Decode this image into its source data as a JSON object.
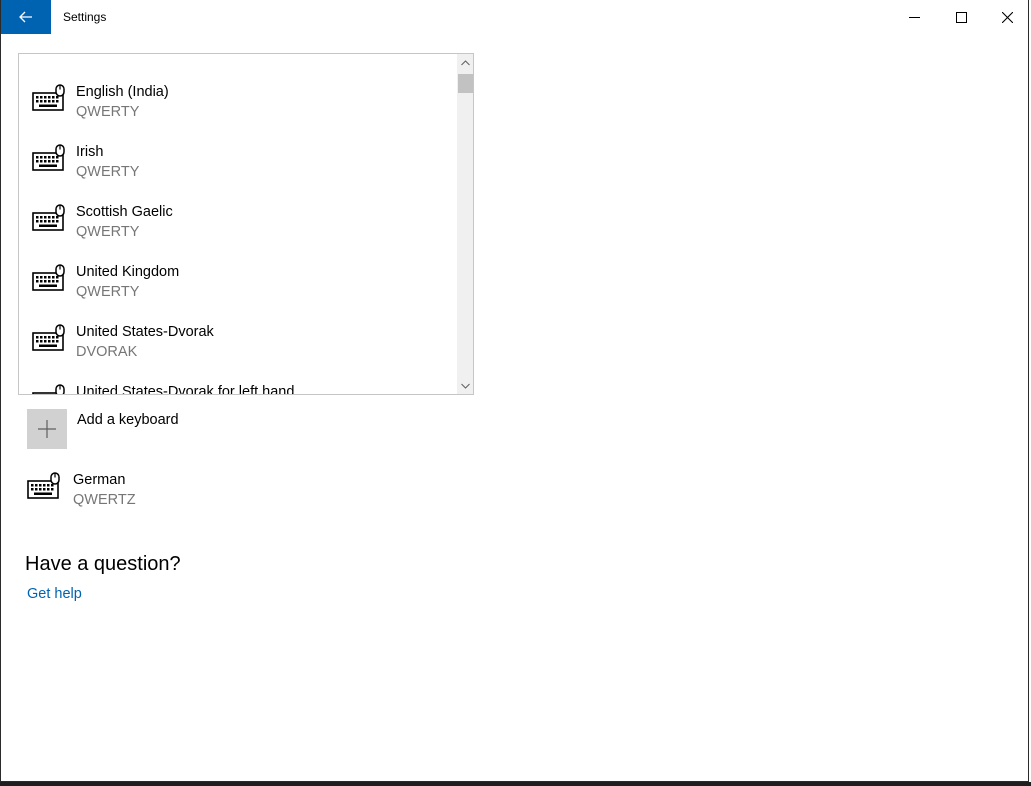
{
  "window": {
    "title": "Settings",
    "accent_color": "#0063b1",
    "back_icon": "arrow-left-icon",
    "caption_icons": [
      "minimize-icon",
      "maximize-icon",
      "close-icon"
    ]
  },
  "keyboard_list": {
    "items": [
      {
        "name": "English (India)",
        "layout": "QWERTY",
        "icon": "keyboard-icon"
      },
      {
        "name": "Irish",
        "layout": "QWERTY",
        "icon": "keyboard-icon"
      },
      {
        "name": "Scottish Gaelic",
        "layout": "QWERTY",
        "icon": "keyboard-icon"
      },
      {
        "name": "United Kingdom",
        "layout": "QWERTY",
        "icon": "keyboard-icon"
      },
      {
        "name": "United States-Dvorak",
        "layout": "DVORAK",
        "icon": "keyboard-icon"
      },
      {
        "name": "United States-Dvorak for left hand",
        "layout": "",
        "icon": "keyboard-icon"
      }
    ]
  },
  "add_keyboard": {
    "label": "Add a keyboard",
    "icon": "plus-icon"
  },
  "installed_keyboards": [
    {
      "name": "German",
      "layout": "QWERTZ",
      "icon": "keyboard-icon"
    }
  ],
  "help": {
    "heading": "Have a question?",
    "link": "Get help"
  }
}
